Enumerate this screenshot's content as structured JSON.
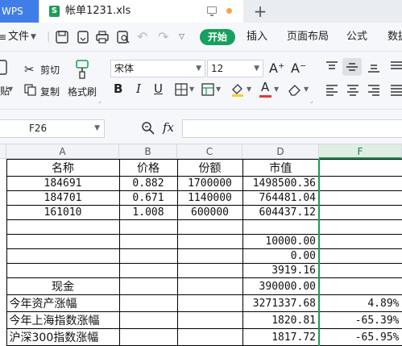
{
  "tabs": {
    "app": "WPS",
    "file_name": "帐单1231.xls",
    "new_tab": "+"
  },
  "menu": {
    "file": "文件",
    "start": "开始",
    "insert": "插入",
    "page_layout": "页面布局",
    "formula": "公式",
    "data": "数据"
  },
  "ribbon": {
    "cut": "剪切",
    "paste": "贴",
    "copy": "复制",
    "format_painter": "格式刷",
    "font_name": "宋体",
    "font_size": "12",
    "bold": "B",
    "italic": "I",
    "underline": "U",
    "grow": "A⁺",
    "shrink": "A⁻"
  },
  "formula_bar": {
    "cell_ref": "F26",
    "fx": "fx",
    "value": ""
  },
  "columns": [
    "A",
    "B",
    "C",
    "D",
    "F"
  ],
  "selected_column": "F",
  "sheet": {
    "headers": [
      "名称",
      "价格",
      "份额",
      "市值"
    ],
    "rows": [
      {
        "a": "184691",
        "b": "0.882",
        "c": "1700000",
        "d": "1498500.36",
        "f": ""
      },
      {
        "a": "184701",
        "b": "0.671",
        "c": "1140000",
        "d": "764481.04",
        "f": ""
      },
      {
        "a": "161010",
        "b": "1.008",
        "c": "600000",
        "d": "604437.12",
        "f": ""
      },
      {
        "a": "",
        "b": "",
        "c": "",
        "d": "",
        "f": ""
      },
      {
        "a": "",
        "b": "",
        "c": "",
        "d": "10000.00",
        "f": ""
      },
      {
        "a": "",
        "b": "",
        "c": "",
        "d": "0.00",
        "f": ""
      },
      {
        "a": "",
        "b": "",
        "c": "",
        "d": "3919.16",
        "f": ""
      },
      {
        "a": "现金",
        "b": "",
        "c": "",
        "d": "390000.00",
        "f": ""
      },
      {
        "a": "今年资产涨幅",
        "b": "",
        "c": "",
        "d": "3271337.68",
        "f": "4.89%"
      },
      {
        "a": "今年上海指数涨幅",
        "b": "",
        "c": "",
        "d": "1820.81",
        "f": "-65.39%"
      },
      {
        "a": "沪深300指数涨幅",
        "b": "",
        "c": "",
        "d": "1817.72",
        "f": "-65.95%"
      }
    ]
  },
  "colors": {
    "accent": "#17a05d",
    "tab_blue": "#3f7ee8"
  }
}
